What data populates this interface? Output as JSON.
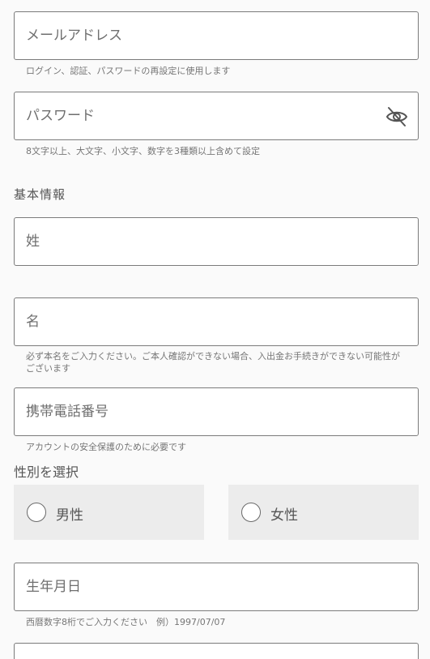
{
  "form": {
    "email": {
      "placeholder": "メールアドレス",
      "helper": "ログイン、認証、パスワードの再設定に使用します"
    },
    "password": {
      "placeholder": "パスワード",
      "helper": "8文字以上、大文字、小文字、数字を3種類以上含めて設定",
      "toggle_icon": "eye-off-icon"
    },
    "basic_info_title": "基本情報",
    "last_name": {
      "placeholder": "姓"
    },
    "first_name": {
      "placeholder": "名",
      "helper": "必ず本名をご入力ください。ご本人確認ができない場合、入出金お手続きができない可能性がございます"
    },
    "phone": {
      "placeholder": "携帯電話番号",
      "helper": "アカウントの安全保護のために必要です"
    },
    "gender": {
      "title": "性別を選択",
      "options": [
        "男性",
        "女性"
      ]
    },
    "birthday": {
      "placeholder": "生年月日",
      "helper": "西暦数字8桁でご入力ください　例）1997/07/07"
    }
  },
  "colors": {
    "background": "#fafafa",
    "border": "#7b7b7b",
    "radio_bg": "#ececec"
  }
}
